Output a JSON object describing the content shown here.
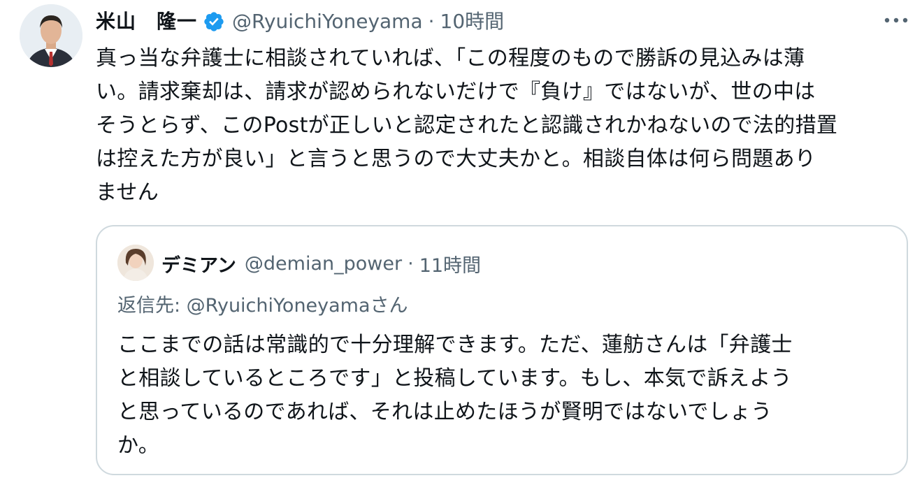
{
  "tweet": {
    "display_name": "米山　隆一",
    "handle": "@RyuichiYoneyama",
    "separator": "·",
    "time": "10時間",
    "more_icon": "more-horizontal-icon",
    "verified_icon": "verified-badge-icon",
    "verified_color": "#1d9bf0",
    "text": "真っ当な弁護士に相談されていれば、「この程度のもので勝訴の見込みは薄\nい。請求棄却は、請求が認められないだけで『負け』ではないが、世の中は\nそうとらず、このPostが正しいと認定されたと認識されかねないので法的措置\nは控えた方が良い」と言うと思うので大丈夫かと。相談自体は何ら問題あり\nません"
  },
  "quoted_tweet": {
    "display_name": "デミアン",
    "handle": "@demian_power",
    "separator": "·",
    "time": "11時間",
    "reply_to": "返信先: @RyuichiYoneyamaさん",
    "text": "ここまでの話は常識的で十分理解できます。ただ、蓮舫さんは「弁護士\nと相談しているところです」と投稿しています。もし、本気で訴えよう\nと思っているのであれば、それは止めたほうが賢明ではないでしょう\nか。"
  },
  "colors": {
    "text_primary": "#0f1419",
    "text_secondary": "#536471",
    "border": "#cfd9de"
  }
}
